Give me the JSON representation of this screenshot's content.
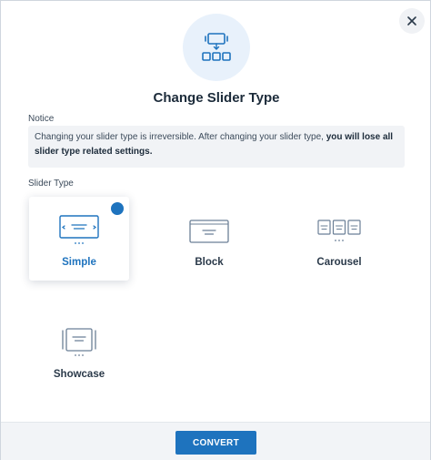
{
  "dialog": {
    "title": "Change Slider Type",
    "close_icon": "close-icon",
    "hero_icon": "slider-hierarchy-icon"
  },
  "notice": {
    "label": "Notice",
    "text_normal": "Changing your slider type is irreversible. After changing your slider type, ",
    "text_bold": "you will lose all slider type related settings."
  },
  "slider_type": {
    "label": "Slider Type",
    "selected": "Simple",
    "options": [
      {
        "label": "Simple",
        "icon": "simple-slider-icon"
      },
      {
        "label": "Block",
        "icon": "block-slider-icon"
      },
      {
        "label": "Carousel",
        "icon": "carousel-slider-icon"
      },
      {
        "label": "Showcase",
        "icon": "showcase-slider-icon"
      }
    ]
  },
  "footer": {
    "convert_label": "CONVERT"
  },
  "colors": {
    "accent": "#1e73be",
    "icon_stroke": "#6b7f96",
    "hero_bg": "#e8f1fb"
  }
}
